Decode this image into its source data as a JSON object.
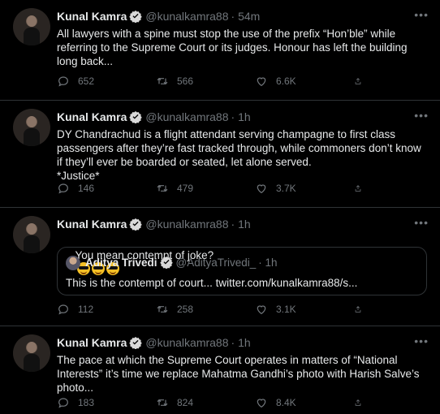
{
  "author": {
    "name": "Kunal Kamra",
    "handle": "@kunalkamra88",
    "verified": true
  },
  "colors": {
    "background": "#000000",
    "text": "#e7e9ea",
    "muted": "#71767b",
    "verified": "#1d9bf0",
    "divider": "#2f3336"
  },
  "icons": [
    "comment-icon",
    "retweet-icon",
    "like-icon",
    "share-icon",
    "more-icon",
    "verified-icon"
  ],
  "tweets": [
    {
      "time": "· 54m",
      "text": "All lawyers with a spine must stop the use of the prefix “Hon’ble” while\nreferring to the Supreme Court or its judges. Honour has left the building\nlong back...",
      "replies": "652",
      "retweets": "566",
      "likes": "6.6K"
    },
    {
      "time": "· 1h",
      "text": "DY Chandrachud is a flight attendant serving champagne to first class\npassengers after they’re fast tracked through, while commoners don’t know\nif they’ll ever be boarded or seated, let alone served.\n*Justice*",
      "replies": "146",
      "retweets": "479",
      "likes": "3.7K"
    },
    {
      "time": "· 1h",
      "text": "You mean contempt of joke?",
      "emoji": "😎😎😎",
      "replies": "112",
      "retweets": "258",
      "likes": "3.1K",
      "quote": {
        "name": "Aditya Trivedi",
        "handle": "@AdityaTrivedi_",
        "time": "· 1h",
        "text": "This is the contempt of court... twitter.com/kunalkamra88/s..."
      }
    },
    {
      "time": "· 1h",
      "text": "The pace at which the Supreme Court operates in matters of “National\nInterests” it’s time we replace Mahatma Gandhi’s photo with Harish Salve’s\nphoto...",
      "replies": "183",
      "retweets": "824",
      "likes": "8.4K"
    }
  ]
}
